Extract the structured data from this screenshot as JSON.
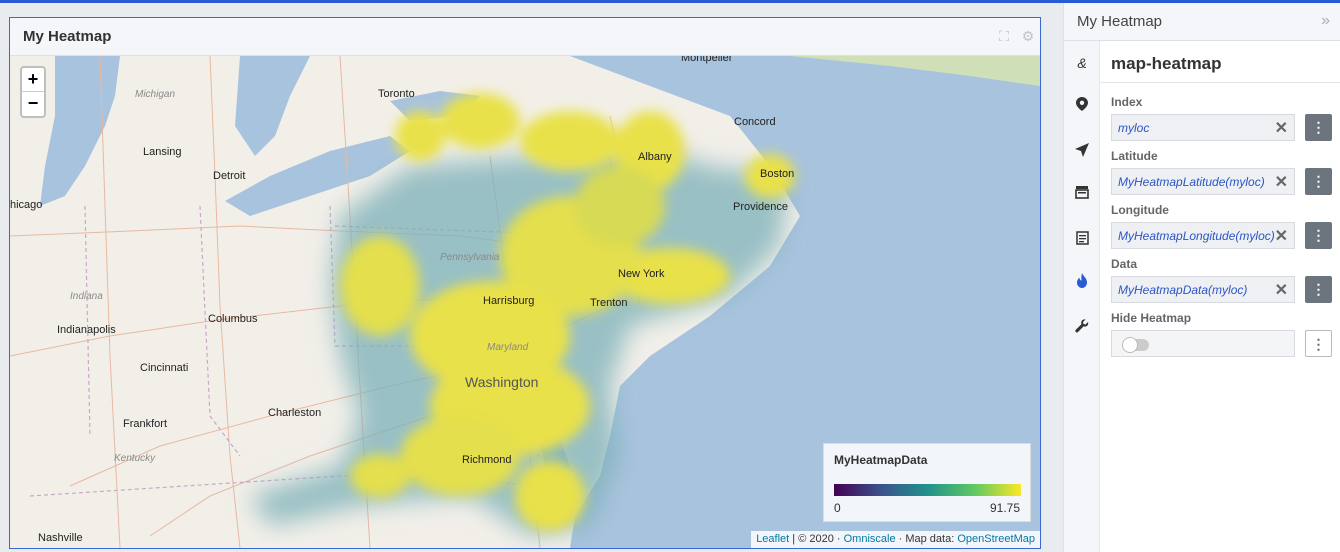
{
  "widget": {
    "title": "My Heatmap"
  },
  "map": {
    "zoom_in": "+",
    "zoom_out": "−",
    "labels": {
      "montpelier": "Montpelier",
      "michigan": "Michigan",
      "toronto": "Toronto",
      "concord": "Concord",
      "lansing": "Lansing",
      "albany": "Albany",
      "detroit": "Detroit",
      "boston": "Boston",
      "chicago": "hicago",
      "providence": "Providence",
      "pennsylvania": "Pennsylvania",
      "newyork": "New York",
      "indiana": "Indiana",
      "harrisburg": "Harrisburg",
      "trenton": "Trenton",
      "columbus": "Columbus",
      "indianapolis": "Indianapolis",
      "maryland": "Maryland",
      "cincinnati": "Cincinnati",
      "washington": "Washington",
      "charleston": "Charleston",
      "frankfort": "Frankfort",
      "kentucky": "Kentucky",
      "richmond": "Richmond",
      "nashville": "Nashville"
    },
    "legend": {
      "title": "MyHeatmapData",
      "min": "0",
      "max": "91.75"
    },
    "attribution": {
      "leaflet": "Leaflet",
      "sep1": " | © 2020 · ",
      "omniscale": "Omniscale",
      "sep2": " · Map data: ",
      "osm": "OpenStreetMap"
    }
  },
  "panel": {
    "title": "My Heatmap",
    "collapse": "»",
    "section_title": "map-heatmap",
    "fields": {
      "index": {
        "label": "Index",
        "value": "myloc"
      },
      "latitude": {
        "label": "Latitude",
        "value": "MyHeatmapLatitude(myloc)"
      },
      "longitude": {
        "label": "Longitude",
        "value": "MyHeatmapLongitude(myloc)"
      },
      "data": {
        "label": "Data",
        "value": "MyHeatmapData(myloc)"
      },
      "hide": {
        "label": "Hide Heatmap"
      }
    },
    "rail_icons": [
      "ampersand-icon",
      "map-pin-icon",
      "navigation-arrow-icon",
      "layers-icon",
      "list-icon",
      "fire-icon",
      "wrench-icon"
    ]
  }
}
